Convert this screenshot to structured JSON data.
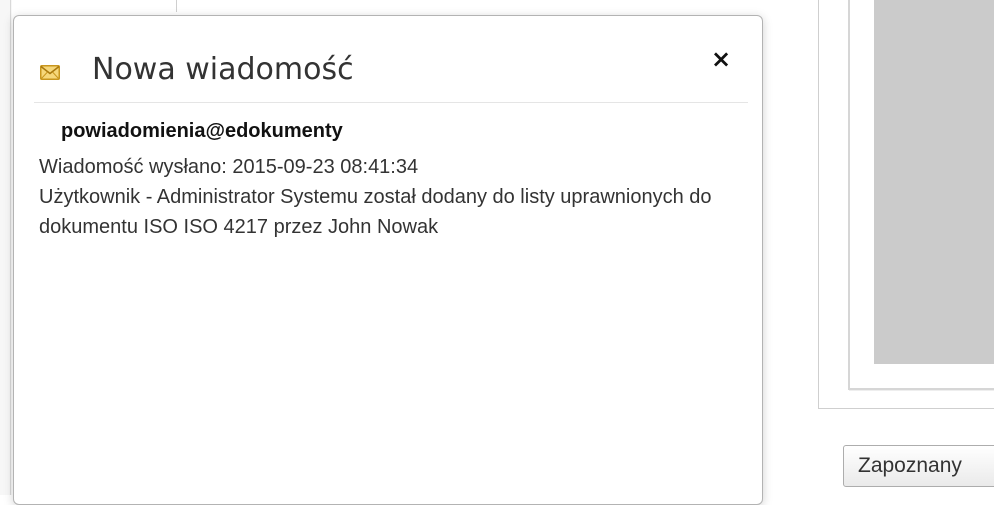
{
  "dialog": {
    "title": "Nowa wiadomość",
    "icon": "envelope-icon",
    "close_label": "×",
    "sender": "powiadomienia@edokumenty",
    "sent_line": "Wiadomość wysłano: 2015-09-23 08:41:34",
    "message": "Użytkownik - Administrator Systemu został dodany do listy uprawnionych do dokumentu ISO ISO 4217 przez John Nowak"
  },
  "background": {
    "acknowledge_button_label": "Zapoznany"
  },
  "colors": {
    "envelope": "#e8b830",
    "preview_grey": "#cbcbcb",
    "title_text": "#333333"
  }
}
